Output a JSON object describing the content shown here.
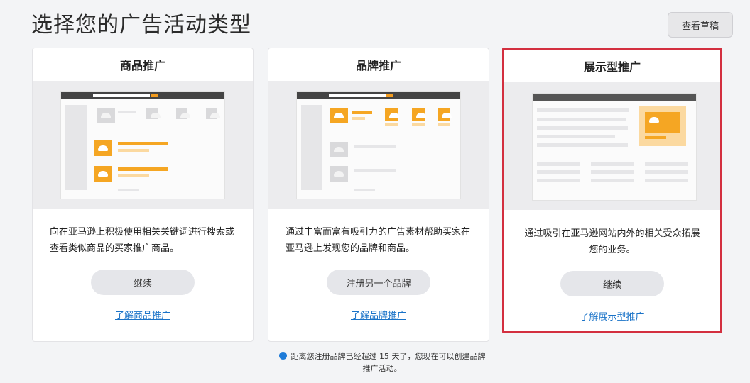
{
  "page": {
    "title": "选择您的广告活动类型"
  },
  "header": {
    "drafts_button": "查看草稿"
  },
  "cards": [
    {
      "title": "商品推广",
      "description": "向在亚马逊上积极使用相关关键词进行搜索或查看类似商品的买家推广商品。",
      "button": "继续",
      "link": "了解商品推广"
    },
    {
      "title": "品牌推广",
      "description": "通过丰富而富有吸引力的广告素材帮助买家在亚马逊上发现您的品牌和商品。",
      "button": "注册另一个品牌",
      "link": "了解品牌推广"
    },
    {
      "title": "展示型推广",
      "description": "通过吸引在亚马逊网站内外的相关受众拓展您的业务。",
      "button": "继续",
      "link": "了解展示型推广",
      "selected": true
    }
  ],
  "notice": {
    "text": "距离您注册品牌已经超过 15 天了，您现在可以创建品牌推广活动。"
  },
  "colors": {
    "accent_orange": "#f5a623",
    "selected_border": "#d32f3f",
    "link_blue": "#1a73c8",
    "info_dot": "#1e7bd8"
  }
}
